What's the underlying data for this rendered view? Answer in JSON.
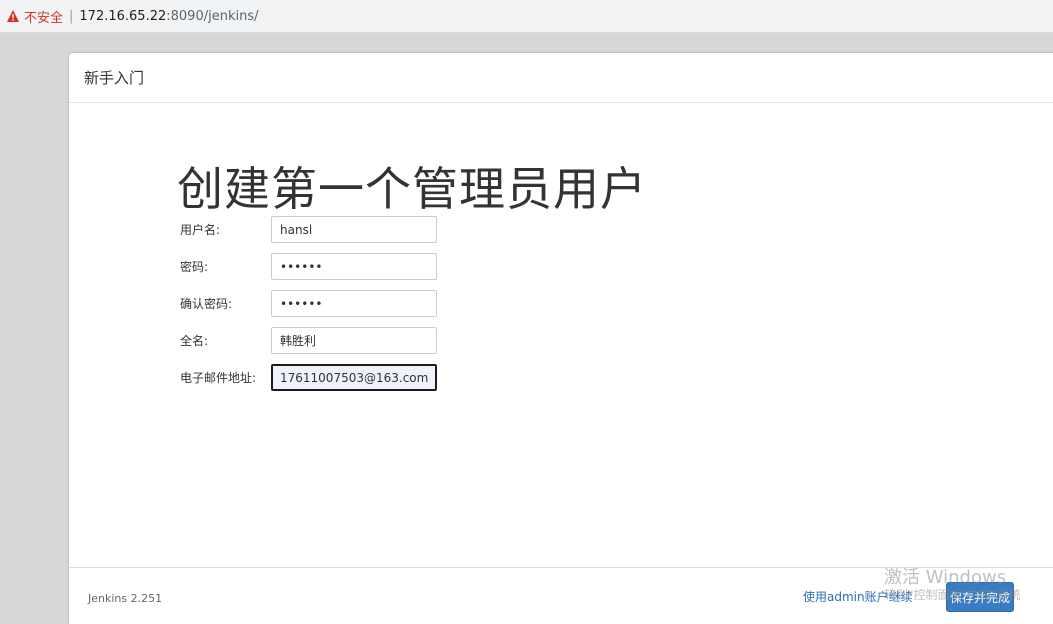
{
  "browser": {
    "security_label": "不安全",
    "separator": "|",
    "url_host": "172.16.65.22",
    "url_rest": ":8090/jenkins/"
  },
  "dialog": {
    "header_title": "新手入门",
    "heading": "创建第一个管理员用户",
    "fields": [
      {
        "label": "用户名:",
        "value": "hansl"
      },
      {
        "label": "密码:",
        "value": "••••••"
      },
      {
        "label": "确认密码:",
        "value": "••••••"
      },
      {
        "label": "全名:",
        "value": "韩胜利"
      },
      {
        "label": "电子邮件地址:",
        "value": "17611007503@163.com"
      }
    ],
    "footer": {
      "version": "Jenkins 2.251",
      "continue_link": "使用admin账户继续",
      "save_button": "保存并完成"
    }
  },
  "watermark": {
    "line1": "激活 Windows",
    "line2": "转到\"控制面板\"中的\"系统"
  },
  "colors": {
    "warning": "#d93025",
    "accent": "#3a7cc1"
  }
}
